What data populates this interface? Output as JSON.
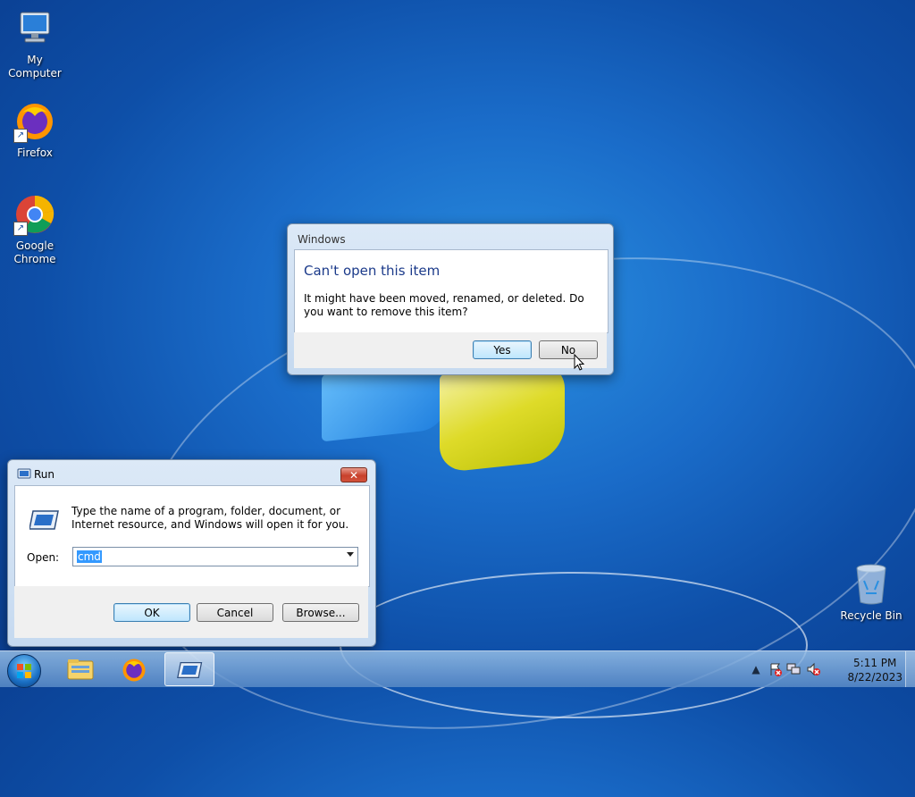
{
  "desktop": {
    "icons": [
      {
        "label": "My Computer"
      },
      {
        "label": "Firefox"
      },
      {
        "label": "Google Chrome"
      },
      {
        "label": "Recycle Bin"
      }
    ]
  },
  "error_dialog": {
    "title": "Windows",
    "heading": "Can't open this item",
    "message": "It might have been moved, renamed, or deleted. Do you want to remove this item?",
    "yes_label": "Yes",
    "no_label": "No"
  },
  "run_dialog": {
    "title": "Run",
    "description": "Type the name of a program, folder, document, or Internet resource, and Windows will open it for you.",
    "open_label": "Open:",
    "open_value": "cmd",
    "ok_label": "OK",
    "cancel_label": "Cancel",
    "browse_label": "Browse..."
  },
  "taskbar": {
    "pinned": [
      {
        "icon": "windows-explorer-icon"
      },
      {
        "icon": "firefox-icon"
      },
      {
        "icon": "run-icon",
        "active": true
      }
    ],
    "tray_icons": [
      "show-hidden-icons",
      "action-center-icon",
      "network-icon",
      "volume-muted-icon"
    ],
    "time": "5:11 PM",
    "date": "8/22/2023"
  },
  "colors": {
    "desktop_bg": "#1a6cc9",
    "dialog_heading": "#1b3a8a",
    "selection": "#3399ff",
    "close_button": "#c8412c"
  }
}
